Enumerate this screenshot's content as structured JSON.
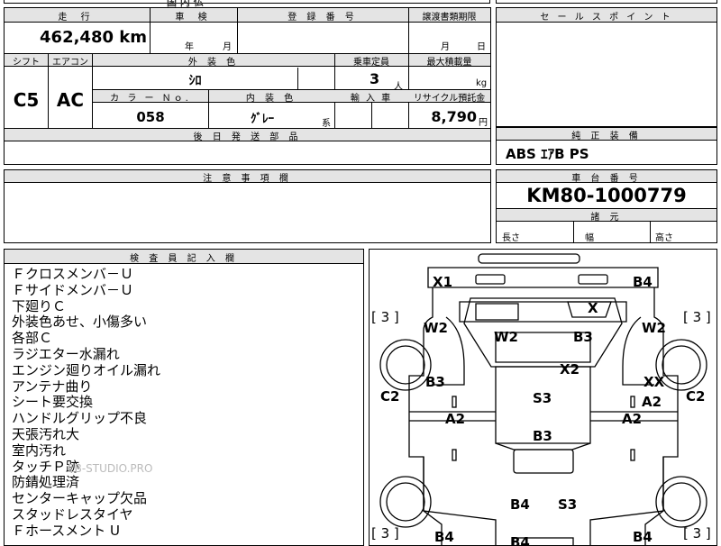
{
  "top_strip": {
    "partial_text": "国 内 仏"
  },
  "mileage": {
    "header": "走 行",
    "value": "462,480 km"
  },
  "shaken": {
    "header": "車 検",
    "year_unit": "年",
    "month_unit": "月"
  },
  "registration": {
    "header": "登 録 番 号",
    "value": ""
  },
  "transfer_deadline": {
    "header": "譲渡書類期限",
    "month_unit": "月",
    "day_unit": "日"
  },
  "sales_point": {
    "header": "セ ー ル ス ポ イ ン ト",
    "value": ""
  },
  "shift": {
    "header": "シフト",
    "value": "C5"
  },
  "aircon": {
    "header": "エアコン",
    "value": "AC"
  },
  "exterior_color": {
    "header": "外 装 色",
    "value": "ｼﾛ"
  },
  "capacity": {
    "header": "乗車定員",
    "value": "3",
    "unit": "人"
  },
  "max_load": {
    "header": "最大積載量",
    "value": "",
    "unit": "kg"
  },
  "color_no": {
    "header": "カ ラ ー Ｎｏ.",
    "value": "058"
  },
  "interior_color": {
    "header": "内 装 色",
    "value": "ｸﾞﾚｰ",
    "suffix": "系"
  },
  "import_car": {
    "header": "輸 入 車",
    "value": ""
  },
  "recycle": {
    "header": "リサイクル預託金",
    "value": "8,790",
    "unit": "円"
  },
  "later_parts": {
    "header": "後 日 発 送 部 品",
    "value": ""
  },
  "oem_equipment": {
    "header": "純 正 装 備",
    "value": "ABS ｴｱB PS"
  },
  "caution": {
    "header": "注 意 事 項 欄",
    "value": ""
  },
  "chassis_number": {
    "header": "車 台 番 号",
    "value": "KM80-1000779"
  },
  "specs": {
    "header": "諸 元",
    "length": "長さ",
    "width": "幅",
    "height": "高さ"
  },
  "inspector_notes": {
    "header": "検 査 員 記 入 欄",
    "lines": [
      "Ｆクロスメンバ－Ｕ",
      "Ｆサイドメンバ－Ｕ",
      "下廻りＣ",
      "外装色あせ、小傷多い",
      "各部Ｃ",
      "ラジエター水漏れ",
      "エンジン廻りオイル漏れ",
      "アンテナ曲り",
      "シート要交換",
      "ハンドルグリップ不良",
      "天張汚れ大",
      "室内汚れ",
      "タッチＰ跡",
      "防錆処理済",
      "センターキャップ欠品",
      "スタッドレスタイヤ",
      "Ｆホースメント U"
    ],
    "watermark": "EB-STUDIO.PRO"
  },
  "diagram": {
    "tire_marks": [
      "[ 3 ]",
      "[ 3 ]",
      "[ 3 ]",
      "[ 3 ]"
    ],
    "marks": {
      "front_left": "X1",
      "front_right": "B4",
      "windshield": "X",
      "front_fender_left": "W2",
      "front_fender_right": "W2",
      "hood_left": "W2",
      "hood_right": "B3",
      "roof_front": "X2",
      "door_left": "B3",
      "door_right_1": "XX",
      "door_right_2": "A2",
      "side_left": "C2",
      "side_right": "C2",
      "pillar_left": "A2",
      "pillar_right": "A2",
      "roof": "S3",
      "rear_deck": "B3",
      "rear_left": "B4",
      "rear_center": "S3",
      "bottom_left": "B4",
      "bottom_center": "B4",
      "bottom_right": "B4"
    }
  }
}
